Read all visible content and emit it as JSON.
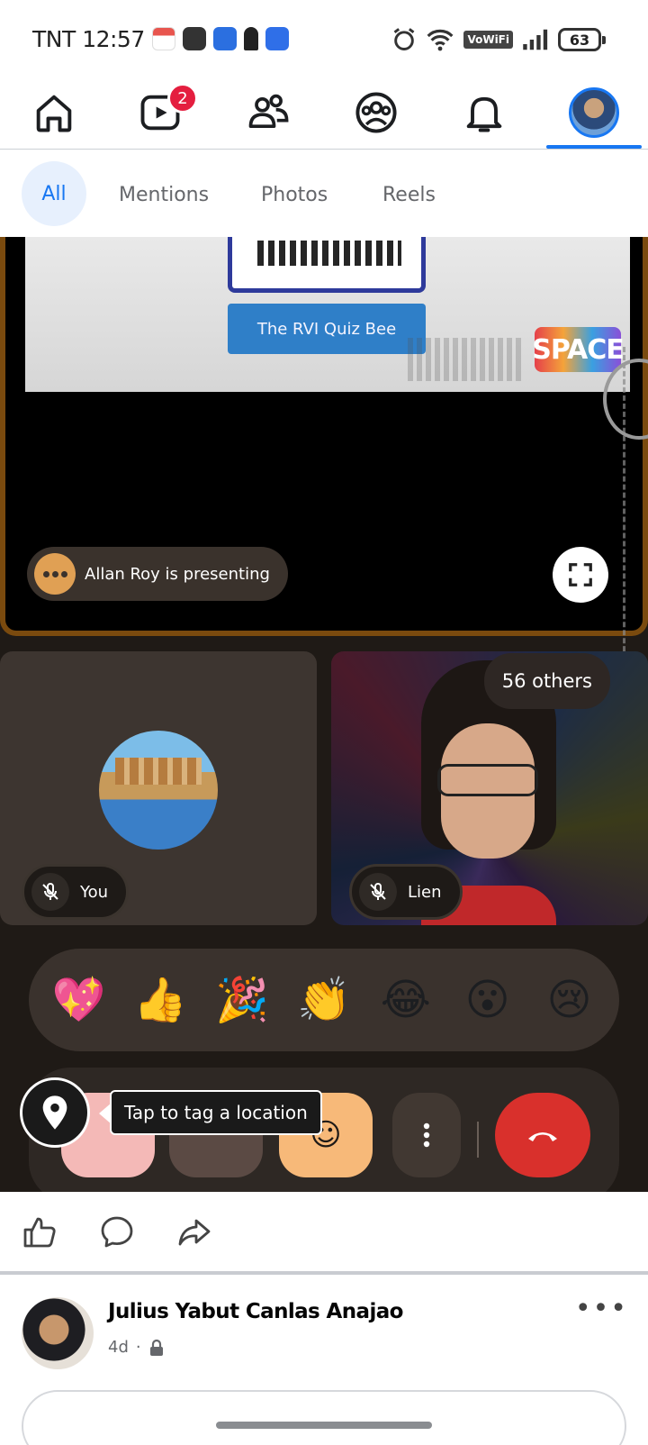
{
  "status_bar": {
    "carrier_time": "TNT 12:57",
    "volte": "VoWiFi",
    "battery": "63"
  },
  "nav": {
    "reels_badge": "2"
  },
  "filter_tabs": [
    "All",
    "Mentions",
    "Photos",
    "Reels"
  ],
  "video_call": {
    "slide_banner": "The RVI Quiz Bee",
    "slide_logo": "SPACE",
    "presenting": "Allan Roy is presenting",
    "participants": [
      {
        "label": "You"
      },
      {
        "label": "Lien"
      }
    ],
    "others": "56 others",
    "reactions": [
      "💖",
      "👍",
      "🎉",
      "👏",
      "😂",
      "😮",
      "😢"
    ],
    "emoji_button": "☺",
    "location_tooltip": "Tap to tag a location"
  },
  "post": {
    "author": "Julius Yabut Canlas Anajao",
    "time": "4d",
    "separator": "·",
    "more": "•••"
  },
  "colors": {
    "brand_blue": "#1877f2",
    "badge_red": "#e41e3f",
    "end_call_red": "#d9302c",
    "presenter_border": "#7a4a0e"
  }
}
